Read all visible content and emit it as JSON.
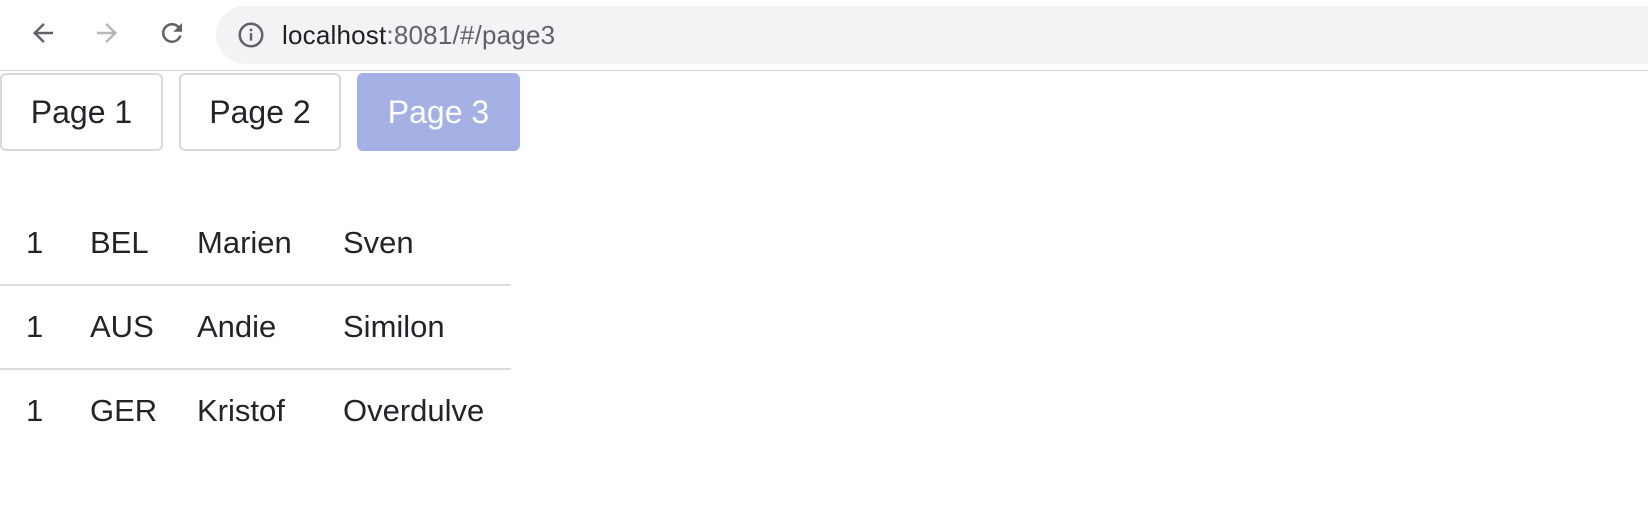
{
  "browser": {
    "url_host": "localhost",
    "url_path": ":8081/#/page3",
    "icons": {
      "back": "arrow-left-icon",
      "forward": "arrow-right-icon",
      "reload": "reload-icon",
      "info": "info-circle-icon"
    }
  },
  "pages": [
    {
      "label": "Page 1",
      "active": false
    },
    {
      "label": "Page 2",
      "active": false
    },
    {
      "label": "Page 3",
      "active": true
    }
  ],
  "colors": {
    "active_button": "#a5b0e4",
    "omnibox": "#f1f3f4"
  },
  "table": {
    "rows": [
      [
        "1",
        "BEL",
        "Marien",
        "Sven"
      ],
      [
        "1",
        "AUS",
        "Andie",
        "Similon"
      ],
      [
        "1",
        "GER",
        "Kristof",
        "Overdulve"
      ]
    ]
  }
}
